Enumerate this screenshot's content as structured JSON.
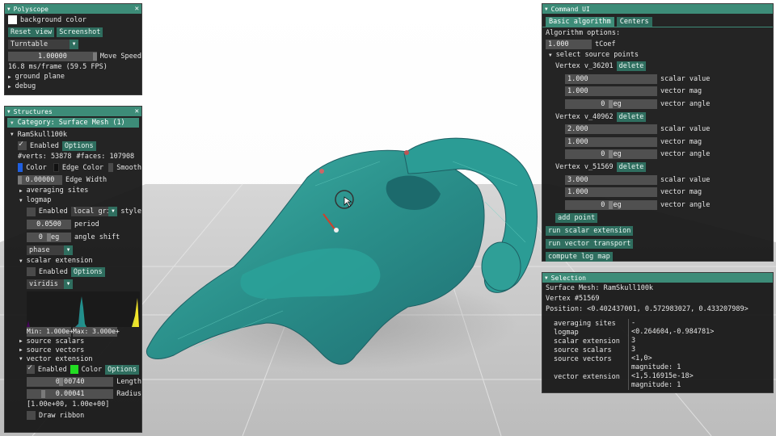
{
  "polyscope": {
    "title": "Polyscope",
    "background_color_label": "background color",
    "reset_view": "Reset view",
    "screenshot": "Screenshot",
    "view_mode": "Turntable",
    "move_speed_value": "1.00000",
    "move_speed_label": "Move Speed",
    "fps": "16.8 ms/frame (59.5 FPS)",
    "ground_plane": "ground plane",
    "debug": "debug"
  },
  "structures": {
    "title": "Structures",
    "category": "Category: Surface Mesh (1)",
    "mesh_name": "RamSkull100k",
    "enabled": "Enabled",
    "options": "Options",
    "verts": "#verts: 53878",
    "faces": "#faces: 107908",
    "color": "Color",
    "edge_color": "Edge Color",
    "smooth": "Smooth",
    "edge_width_value": "0.00000",
    "edge_width_label": "Edge Width",
    "averaging_sites": "averaging sites",
    "logmap": "logmap",
    "logmap_style": "local gri",
    "style": "style",
    "period_value": "0.0500",
    "period": "period",
    "angle_value": "0 deg",
    "angle_shift": "angle shift",
    "phase": "phase",
    "scalar_extension": "scalar extension",
    "colormap": "viridis",
    "hist_min": "Min: 1.000e+",
    "hist_max": "Max: 3.000e+",
    "source_scalars": "source scalars",
    "source_vectors": "source vectors",
    "vector_extension": "vector extension",
    "length_value": "0.00740",
    "length": "Length",
    "radius_value": "0.00041",
    "radius": "Radius",
    "range": "[1.00e+00, 1.00e+00]",
    "draw_ribbon": "Draw ribbon",
    "colors": {
      "mesh": "#1f5fe0",
      "edge": "#111111",
      "vector": "#22dd22"
    }
  },
  "command": {
    "title": "Command UI",
    "tab_basic": "Basic algorithm",
    "tab_centers": "Centers",
    "algo_options": "Algorithm options:",
    "tcoef_value": "1.000",
    "tcoef": "tCoef",
    "select_source": "select source points",
    "delete": "delete",
    "scalar_value": "scalar value",
    "vector_mag": "vector mag",
    "vector_angle": "vector angle",
    "deg": "0 deg",
    "vertices": [
      {
        "name": "Vertex v_36201",
        "scalar": "1.000",
        "mag": "1.000"
      },
      {
        "name": "Vertex v_40962",
        "scalar": "2.000",
        "mag": "1.000"
      },
      {
        "name": "Vertex v_51569",
        "scalar": "3.000",
        "mag": "1.000"
      }
    ],
    "add_point": "add point",
    "run_scalar": "run scalar extension",
    "run_vector": "run vector transport",
    "compute_log": "compute log map"
  },
  "selection": {
    "title": "Selection",
    "mesh": "Surface Mesh: RamSkull100k",
    "vertex": "Vertex #51569",
    "position": "Position: <0.402437001, 0.572983027, 0.433207989>",
    "rows": [
      {
        "k": "averaging sites",
        "v": "-"
      },
      {
        "k": "logmap",
        "v": "<0.264604,-0.984781>"
      },
      {
        "k": "scalar extension",
        "v": "3"
      },
      {
        "k": "source scalars",
        "v": "3"
      },
      {
        "k": "source vectors",
        "v": "<1,0>"
      },
      {
        "k": "",
        "v": "magnitude: 1"
      },
      {
        "k": "vector extension",
        "v": "<1,5.16915e-18>"
      },
      {
        "k": "",
        "v": "magnitude: 1"
      }
    ]
  },
  "colors": {
    "accent": "#3d8c78",
    "button": "#2f6e5f",
    "mesh_fill": "#2e9a93"
  }
}
